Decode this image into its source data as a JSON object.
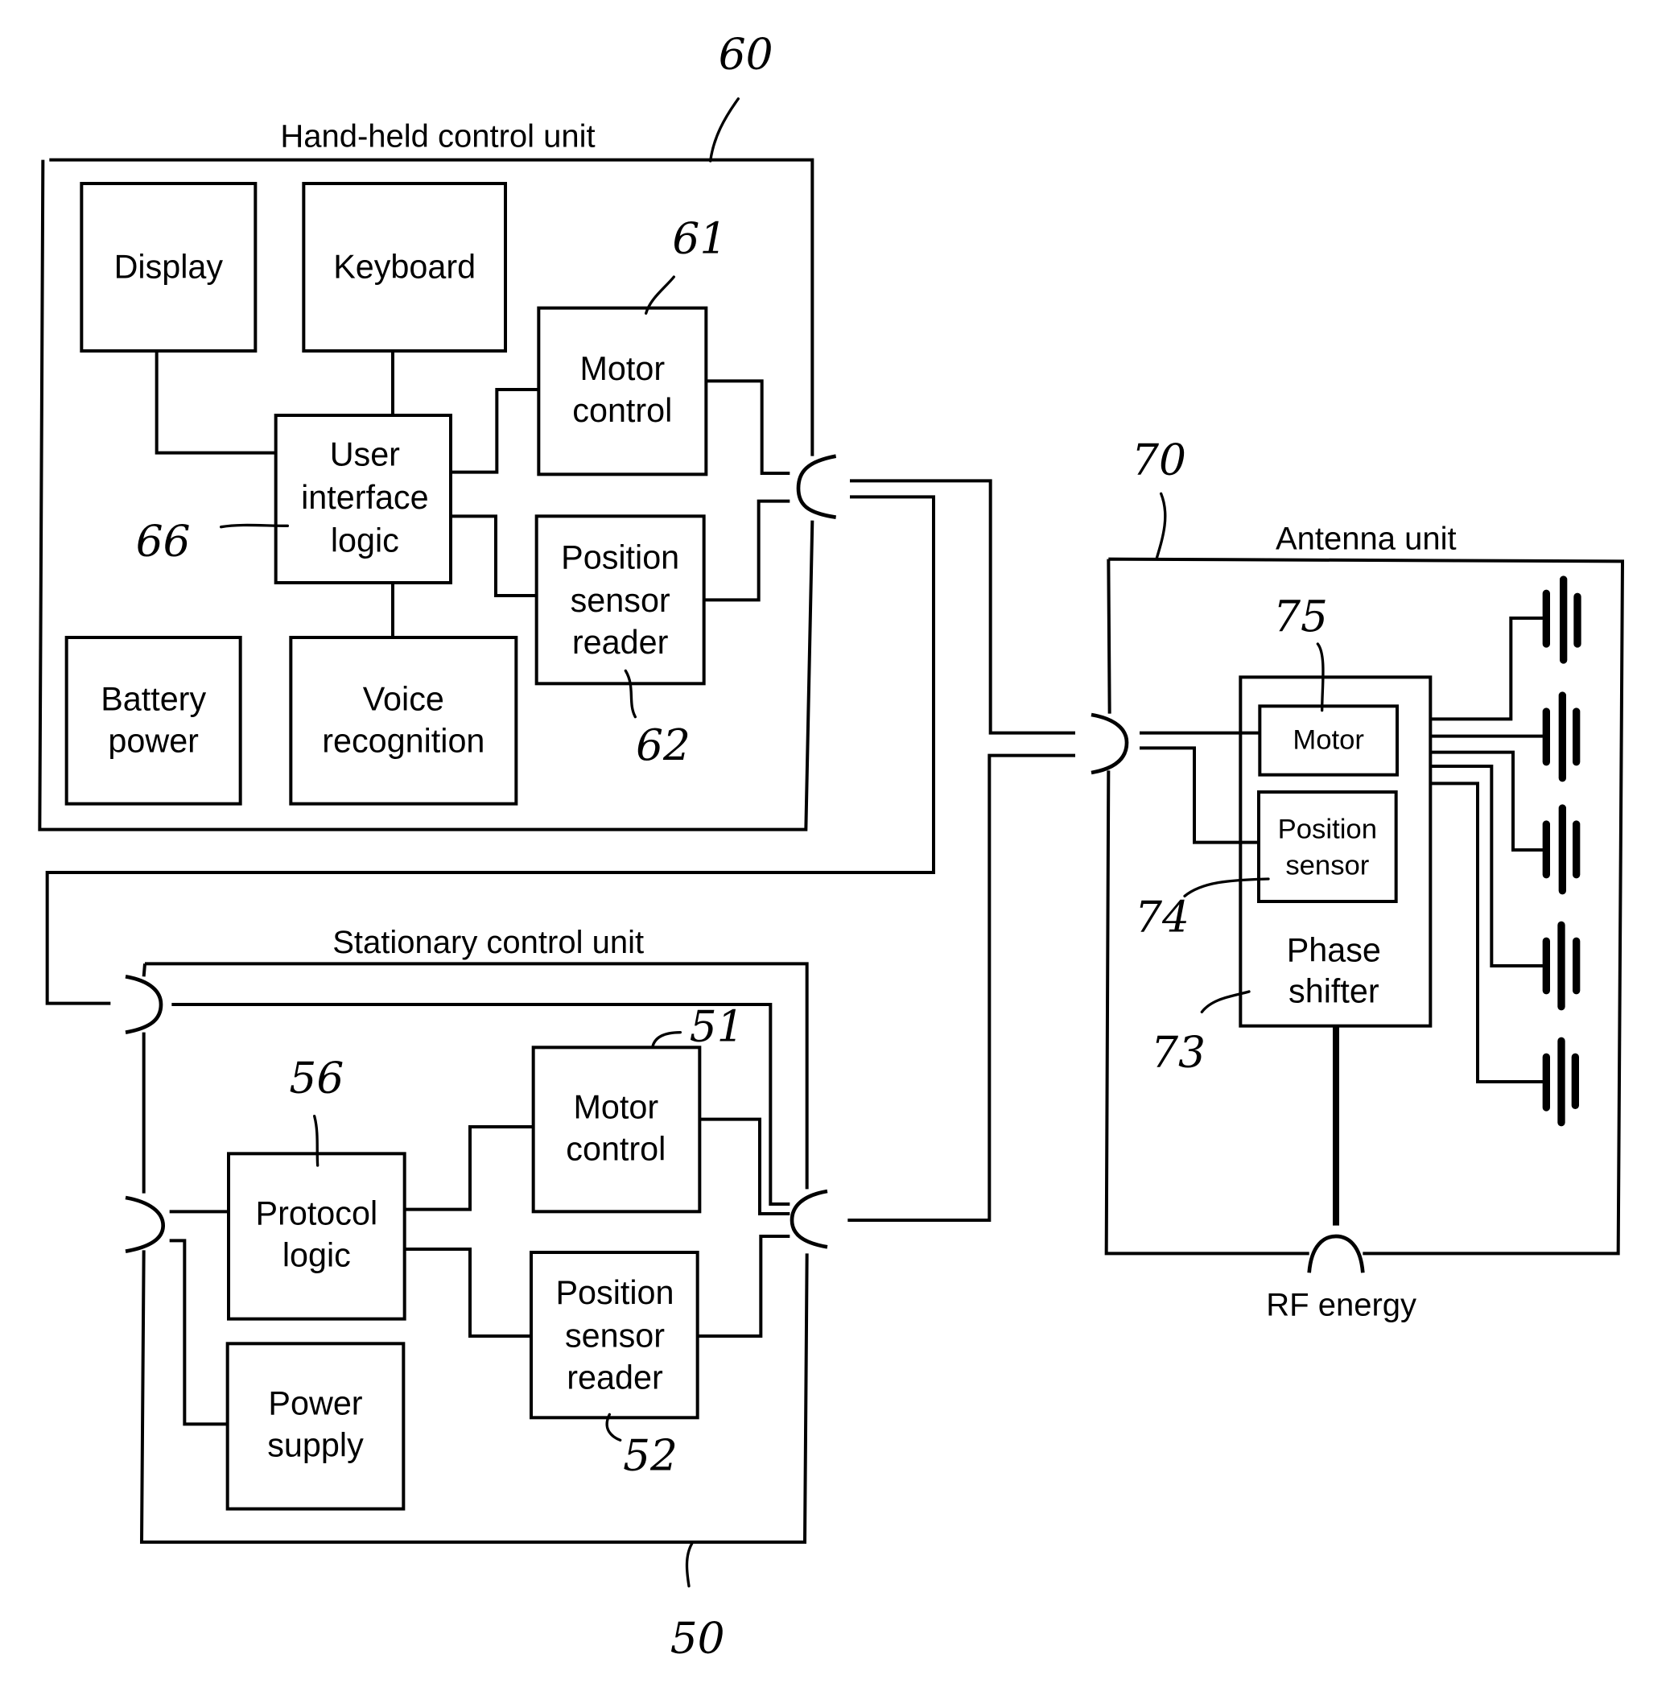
{
  "diagram": {
    "handheld_unit": {
      "title": "Hand-held control unit",
      "ref": "60",
      "blocks": {
        "display": [
          "Display"
        ],
        "keyboard": [
          "Keyboard"
        ],
        "motor_control": [
          "Motor",
          "control"
        ],
        "ui_logic": [
          "User",
          "interface",
          "logic"
        ],
        "position_reader": [
          "Position",
          "sensor",
          "reader"
        ],
        "battery": [
          "Battery",
          "power"
        ],
        "voice": [
          "Voice",
          "recognition"
        ]
      },
      "refs": {
        "motor_control": "61",
        "position_reader": "62",
        "ui_logic": "66"
      }
    },
    "antenna_unit": {
      "title": "Antenna unit",
      "ref": "70",
      "blocks": {
        "motor": [
          "Motor"
        ],
        "position_sensor": [
          "Position",
          "sensor"
        ],
        "phase_shifter": [
          "Phase",
          "shifter"
        ]
      },
      "refs": {
        "motor": "75",
        "position_sensor": "74",
        "phase_shifter": "73"
      },
      "antenna_element_count": 5,
      "rf_label": "RF energy"
    },
    "stationary_unit": {
      "title": "Stationary control unit",
      "ref": "50",
      "blocks": {
        "protocol_logic": [
          "Protocol",
          "logic"
        ],
        "power_supply": [
          "Power",
          "supply"
        ],
        "motor_control": [
          "Motor",
          "control"
        ],
        "position_reader": [
          "Position",
          "sensor",
          "reader"
        ]
      },
      "refs": {
        "motor_control": "51",
        "position_reader": "52",
        "protocol_logic": "56"
      }
    }
  }
}
